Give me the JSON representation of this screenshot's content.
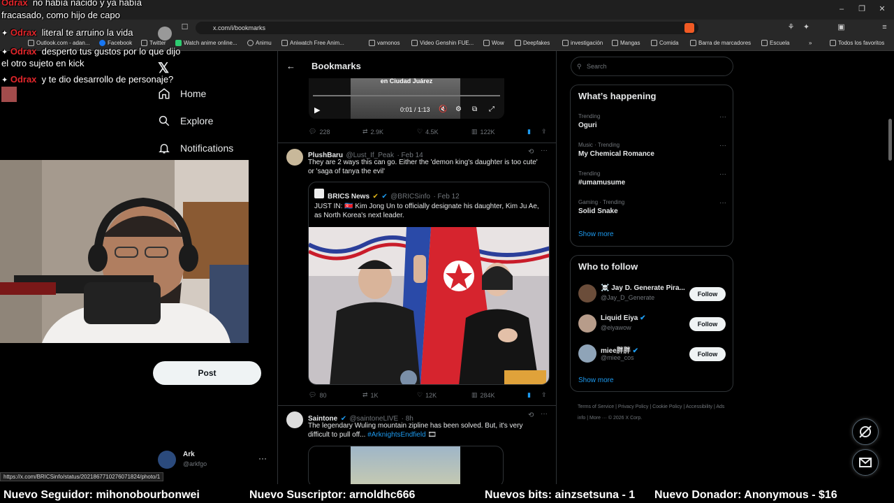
{
  "browser": {
    "url": "x.com/i/bookmarks",
    "bookmarks": [
      "Outlook.com - adan...",
      "Facebook",
      "Twitter",
      "Watch anime online...",
      "Animu",
      "Aniwatch Free Anim...",
      "vamonos",
      "Video Genshin FUE...",
      "Wow",
      "Deepfakes",
      "investigación",
      "Mangas",
      "Comida",
      "Barra de marcadores",
      "Escuela"
    ],
    "all_bookmarks": "Todos los favoritos",
    "status_url": "https://x.com/BRICSinfo/status/2021867710276071824/photo/1"
  },
  "nav": {
    "home": "Home",
    "explore": "Explore",
    "notifications": "Notifications",
    "post": "Post",
    "account_name": "Ark",
    "account_handle": "@arkfgo"
  },
  "header": {
    "title": "Bookmarks"
  },
  "video": {
    "caption": "en Ciudad Juárez",
    "time": "0:01 / 1:13"
  },
  "tweets": [
    {
      "replies": "228",
      "reposts": "2.9K",
      "likes": "4.5K",
      "views": "122K"
    },
    {
      "name": "PlushBaru",
      "handle": "@Lust_If_Peak",
      "date": "· Feb 14",
      "text": "They are 2 ways this can go. Either the 'demon king's daughter is too cute' or 'saga of tanya the evil'",
      "quote": {
        "name": "BRICS News",
        "handle": "@BRICSinfo",
        "date": "· Feb 12",
        "text": "JUST IN: 🇰🇵 Kim Jong Un to officially designate his daughter, Kim Ju Ae, as North Korea's next leader."
      },
      "replies": "80",
      "reposts": "1K",
      "likes": "12K",
      "views": "284K"
    },
    {
      "name": "Saintone",
      "handle": "@saintoneLIVE",
      "date": "· 8h",
      "text": "The legendary Wuling mountain zipline has been solved. But, it's very difficult to pull off...",
      "hashtag": "#ArknightsEndfield"
    }
  ],
  "search": {
    "placeholder": "Search"
  },
  "happening": {
    "title": "What’s happening",
    "trends": [
      {
        "category": "Trending",
        "name": "Oguri"
      },
      {
        "category": "Music · Trending",
        "name": "My Chemical Romance"
      },
      {
        "category": "Trending",
        "name": "#umamusume"
      },
      {
        "category": "Gaming · Trending",
        "name": "Solid Snake"
      }
    ],
    "show_more": "Show more"
  },
  "who_to_follow": {
    "title": "Who to follow",
    "accounts": [
      {
        "name": "☠️ Jay D. Generate Pira...",
        "handle": "@Jay_D_Generate"
      },
      {
        "name": "Liquid Eiya",
        "handle": "@eiyawow"
      },
      {
        "name": "miee胖胖",
        "handle": "@miee_cos"
      }
    ],
    "follow_label": "Follow",
    "show_more": "Show more"
  },
  "footer": [
    "Terms of Service",
    "Privacy Policy",
    "Cookie Policy",
    "Accessibility",
    "Ads info",
    "More ···",
    "© 2026 X Corp."
  ],
  "chat": [
    {
      "user": "Odrax",
      "message": "no había nacido y ya había"
    },
    {
      "user": "",
      "message": "fracasado, como hijo de capo"
    },
    {
      "user": "Odrax",
      "message": "literal te arruino la vida"
    },
    {
      "user": "Odrax",
      "message": "desperto tus gustos por lo que dijo"
    },
    {
      "user": "",
      "message": "el otro sujeto en kick"
    },
    {
      "user": "Odrax",
      "message": "y te dio desarrollo de personaje?"
    }
  ],
  "ticker": [
    "Nuevo Seguidor: mihonobourbonwei",
    "Nuevo Suscriptor: arnoldhc666",
    "Nuevos bits: ainzsetsuna - 1",
    "Nuevo Donador: Anonymous - $16"
  ],
  "colors": {
    "accent": "#1d9bf0",
    "chat_user": "#e3262b",
    "background": "#000000"
  }
}
